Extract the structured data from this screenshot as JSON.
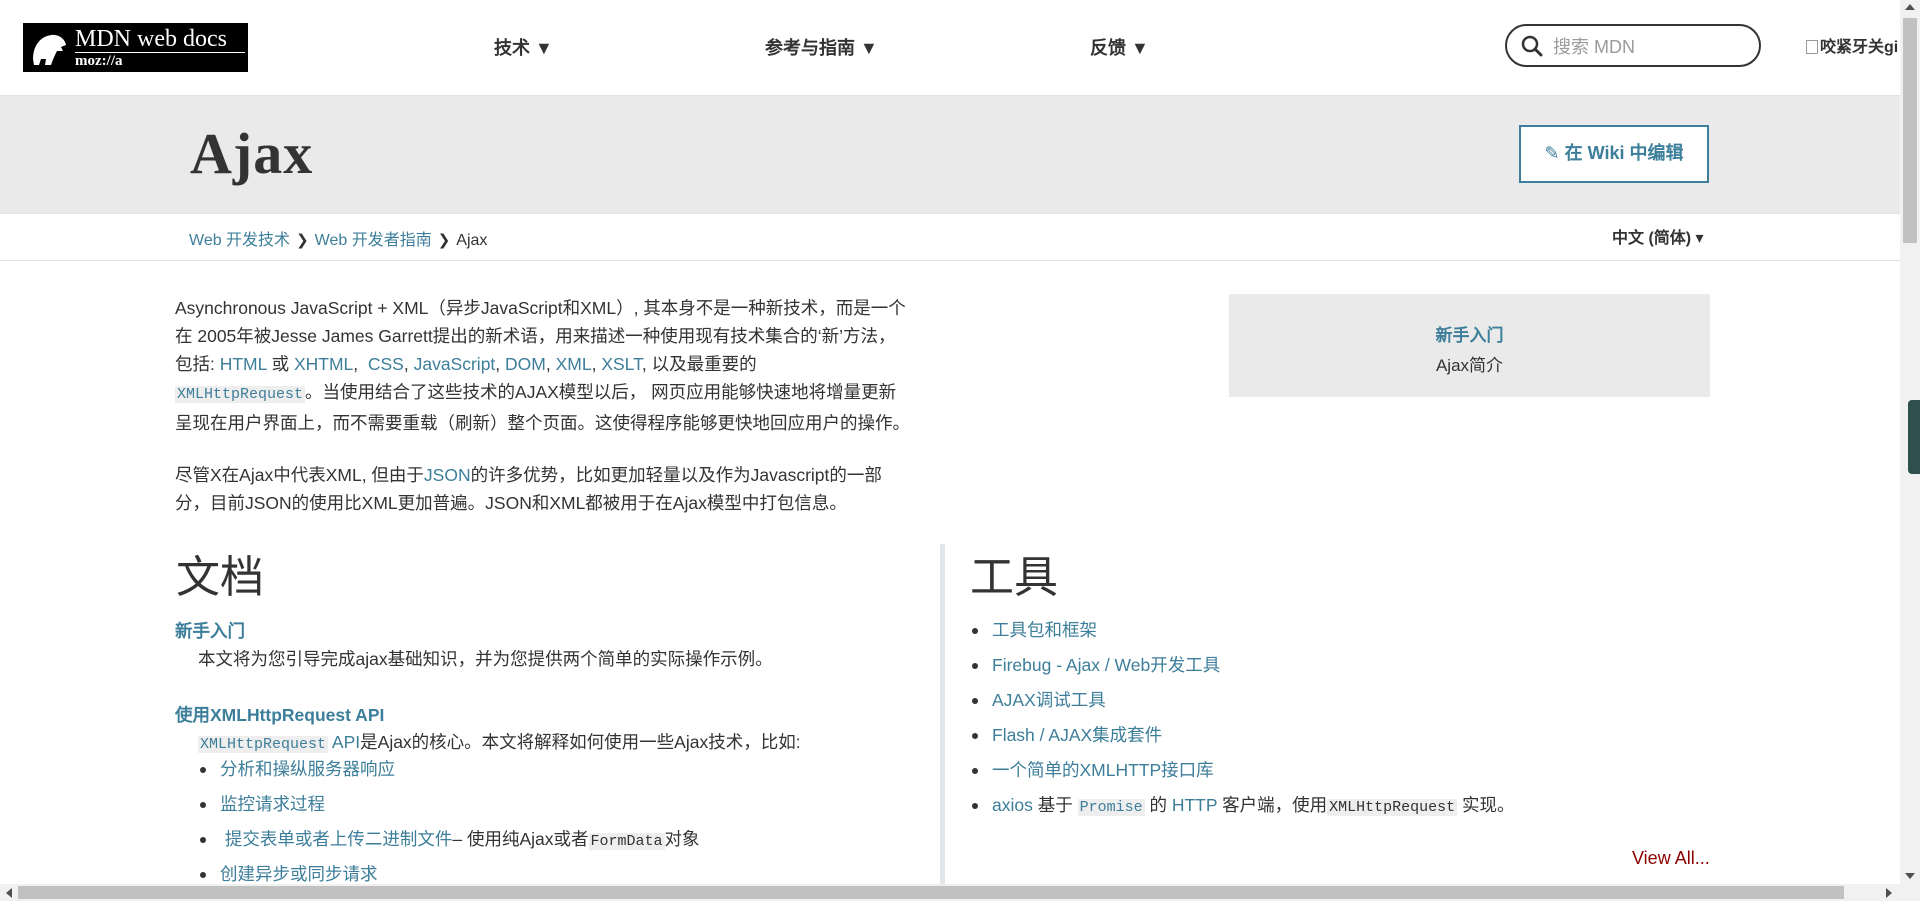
{
  "header": {
    "logo_main": "MDN web docs",
    "logo_sub": "moz://a",
    "nav": [
      {
        "label": "技术 ▼"
      },
      {
        "label": "参考与指南 ▼"
      },
      {
        "label": "反馈 ▼"
      }
    ],
    "search_placeholder": "搜索 MDN",
    "avatar_alt": "咬紧牙关gi"
  },
  "titleband": {
    "title": "Ajax",
    "edit_button": "在 Wiki 中编辑"
  },
  "breadcrumb": {
    "items": [
      "Web 开发技术",
      "Web 开发者指南",
      "Ajax"
    ],
    "language": "中文 (简体) ▾"
  },
  "intro": {
    "p1_line1": "Asynchronous JavaScript + XML（异步JavaScript和XML）, 其本身不是一种新技术，而是一个",
    "p1_line2": "在 2005年被Jesse James Garrett提出的新术语，用来描述一种使用现有技术集合的‘新’方法，",
    "p1_line3_prefix": "包括: ",
    "tech_html": "HTML",
    "or": " 或 ",
    "tech_xhtml": "XHTML",
    "tech_css": "CSS",
    "tech_js": "JavaScript",
    "tech_dom": "DOM",
    "tech_xml": "XML",
    "tech_xslt": "XSLT",
    "p1_line3_suffix": ", 以及最重要的",
    "xhr_code": "XMLHttpRequest",
    "p1_line4_suffix": "。当使用结合了这些技术的AJAX模型以后， 网页应用能够快速地将增量更新",
    "p1_line5": "呈现在用户界面上，而不需要重载（刷新）整个页面。这使得程序能够更快地回应用户的操作。",
    "p2_prefix": "尽管X在Ajax中代表XML, 但由于",
    "p2_json": "JSON",
    "p2_line1_suffix": "的许多优势，比如更加轻量以及作为Javascript的一部",
    "p2_line2": "分，目前JSON的使用比XML更加普遍。JSON和XML都被用于在Ajax模型中打包信息。"
  },
  "quickbox": {
    "heading": "新手入门",
    "sub": "Ajax简介"
  },
  "docs": {
    "heading": "文档",
    "item1_title": "新手入门",
    "item1_desc": "本文将为您引导完成ajax基础知识，并为您提供两个简单的实际操作示例。",
    "item2_title": "使用XMLHttpRequest API",
    "item2_code": "XMLHttpRequest",
    "item2_api": " API",
    "item2_desc": "是Ajax的核心。本文将解释如何使用一些Ajax技术，比如:",
    "bullets": [
      {
        "link": "分析和操纵服务器响应"
      },
      {
        "link": "监控请求过程"
      },
      {
        "link": "提交表单或者上传二进制文件",
        "suffix": "– 使用纯Ajax或者",
        "code": "FormData",
        "tail": "对象"
      },
      {
        "link": "创建异步或同步请求"
      }
    ]
  },
  "tools": {
    "heading": "工具",
    "items": [
      {
        "link": "工具包和框架"
      },
      {
        "link": "Firebug - Ajax / Web开发工具"
      },
      {
        "link": "AJAX调试工具"
      },
      {
        "link": "Flash / AJAX集成套件"
      },
      {
        "link": "一个简单的XMLHTTP接口库"
      }
    ],
    "last_link1": "axios",
    "last_text1": " 基于 ",
    "last_code1": "Promise",
    "last_text2": " 的 ",
    "last_link2": "HTTP",
    "last_text3": " 客户端，使用",
    "last_code2": "XMLHttpRequest",
    "last_text4": " 实现。",
    "view_all": "View All..."
  },
  "colors": {
    "link": "#3d7e9a",
    "view_all": "#8b0000",
    "band": "#eaeaea"
  }
}
